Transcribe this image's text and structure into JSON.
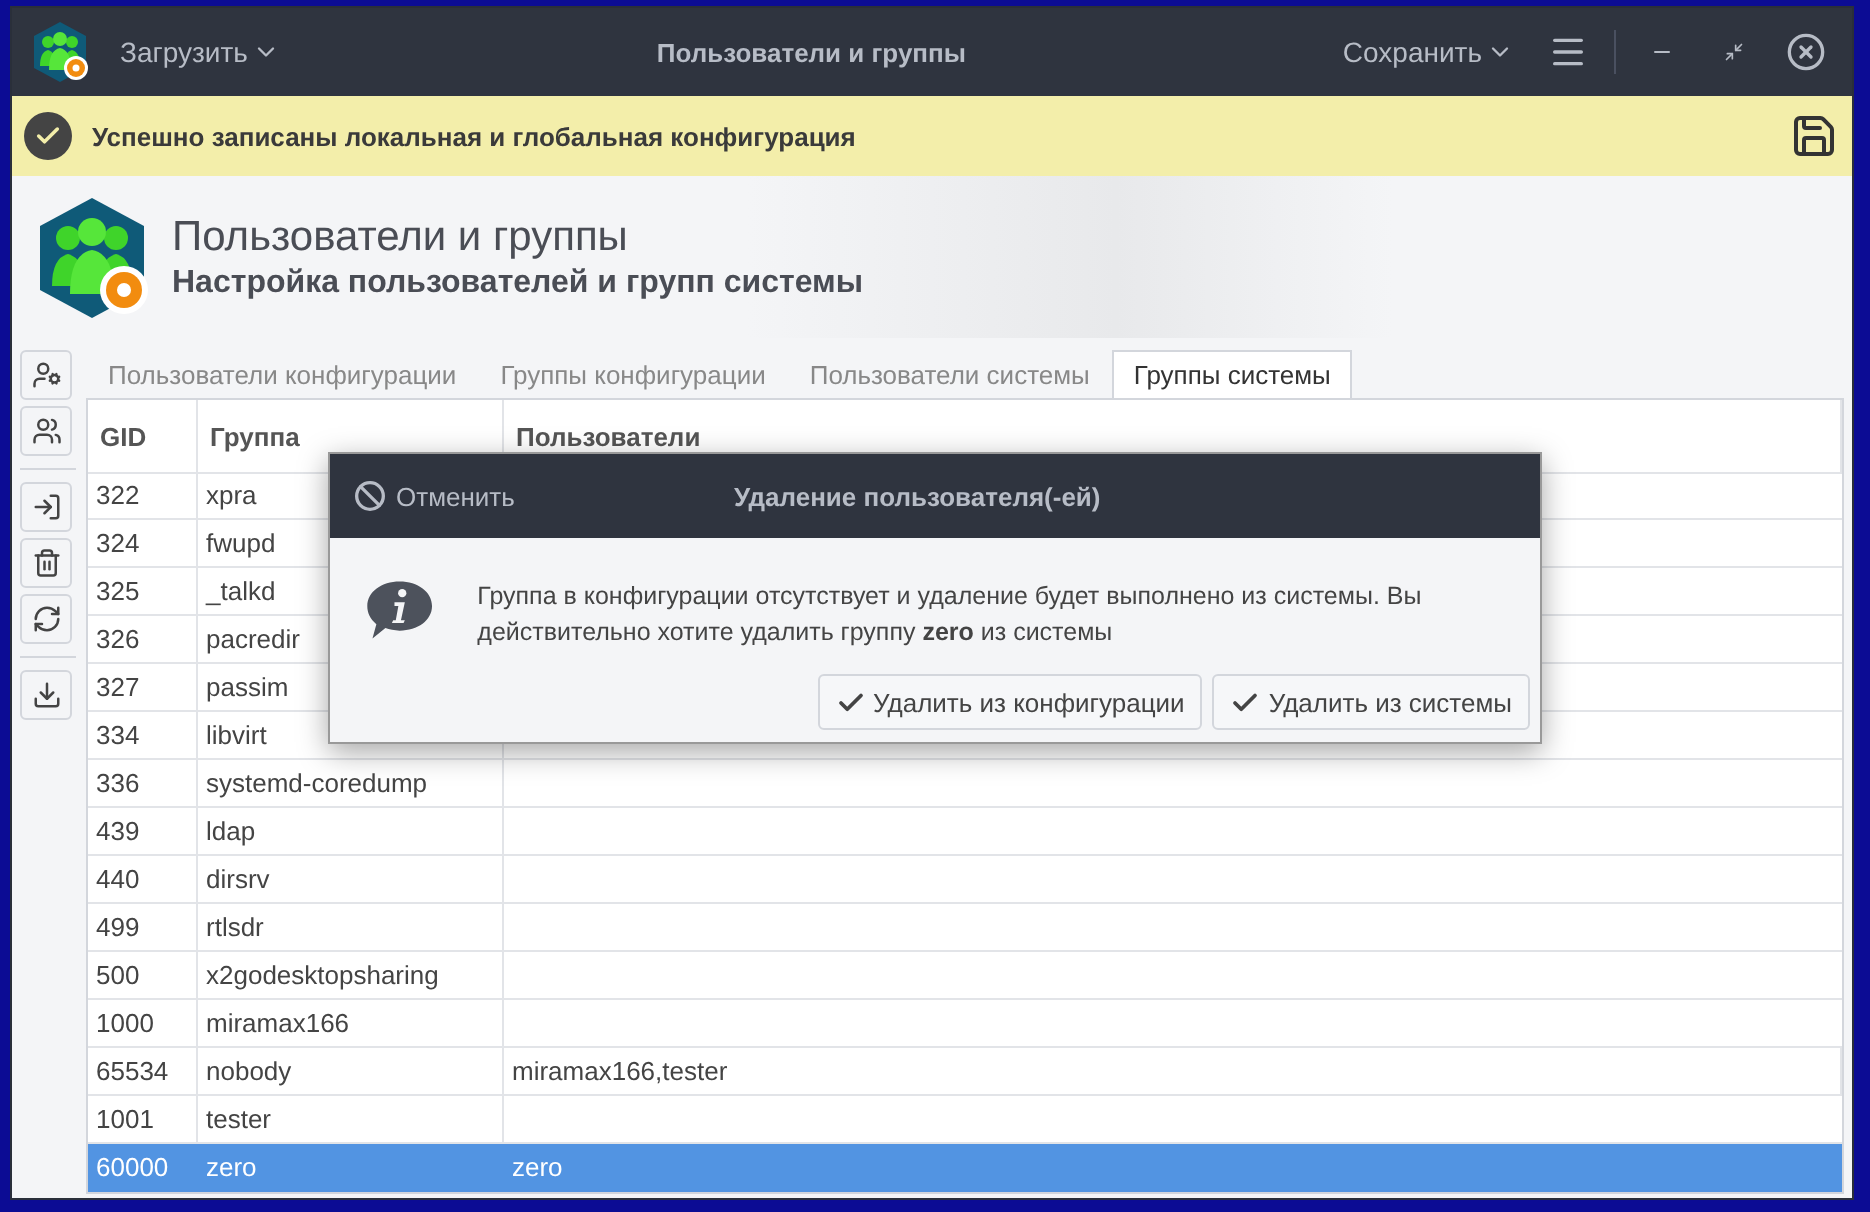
{
  "window": {
    "title": "Пользователи и группы",
    "load_menu": "Загрузить",
    "save_menu": "Сохранить"
  },
  "notification": {
    "text": "Успешно записаны локальная и глобальная конфигурация"
  },
  "header": {
    "title": "Пользователи и группы",
    "subtitle": "Настройка пользователей и групп системы"
  },
  "tabs": [
    {
      "label": "Пользователи конфигурации",
      "selected": false
    },
    {
      "label": "Группы конфигурации",
      "selected": false
    },
    {
      "label": "Пользователи системы",
      "selected": false
    },
    {
      "label": "Группы системы",
      "selected": true
    }
  ],
  "table": {
    "columns": [
      "GID",
      "Группа",
      "Пользователи"
    ],
    "rows": [
      {
        "gid": "322",
        "group": "xpra",
        "users": "",
        "selected": false
      },
      {
        "gid": "324",
        "group": "fwupd",
        "users": "",
        "selected": false
      },
      {
        "gid": "325",
        "group": "_talkd",
        "users": "",
        "selected": false
      },
      {
        "gid": "326",
        "group": "pacredir",
        "users": "",
        "selected": false
      },
      {
        "gid": "327",
        "group": "passim",
        "users": "",
        "selected": false
      },
      {
        "gid": "334",
        "group": "libvirt",
        "users": "",
        "selected": false
      },
      {
        "gid": "336",
        "group": "systemd-coredump",
        "users": "",
        "selected": false
      },
      {
        "gid": "439",
        "group": "ldap",
        "users": "",
        "selected": false
      },
      {
        "gid": "440",
        "group": "dirsrv",
        "users": "",
        "selected": false
      },
      {
        "gid": "499",
        "group": "rtlsdr",
        "users": "",
        "selected": false
      },
      {
        "gid": "500",
        "group": "x2godesktopsharing",
        "users": "",
        "selected": false
      },
      {
        "gid": "1000",
        "group": "miramax166",
        "users": "",
        "selected": false
      },
      {
        "gid": "65534",
        "group": "nobody",
        "users": "miramax166,tester",
        "selected": false
      },
      {
        "gid": "1001",
        "group": "tester",
        "users": "",
        "selected": false
      },
      {
        "gid": "60000",
        "group": "zero",
        "users": "zero",
        "selected": true
      }
    ]
  },
  "dialog": {
    "cancel": "Отменить",
    "title": "Удаление пользователя(-ей)",
    "message": "Группа в конфигурации отсутствует и удаление будет выполнено из системы. Вы действительно хотите удалить группу **zero** из системы",
    "buttons": [
      "Удалить из конфигурации",
      "Удалить из системы"
    ]
  }
}
